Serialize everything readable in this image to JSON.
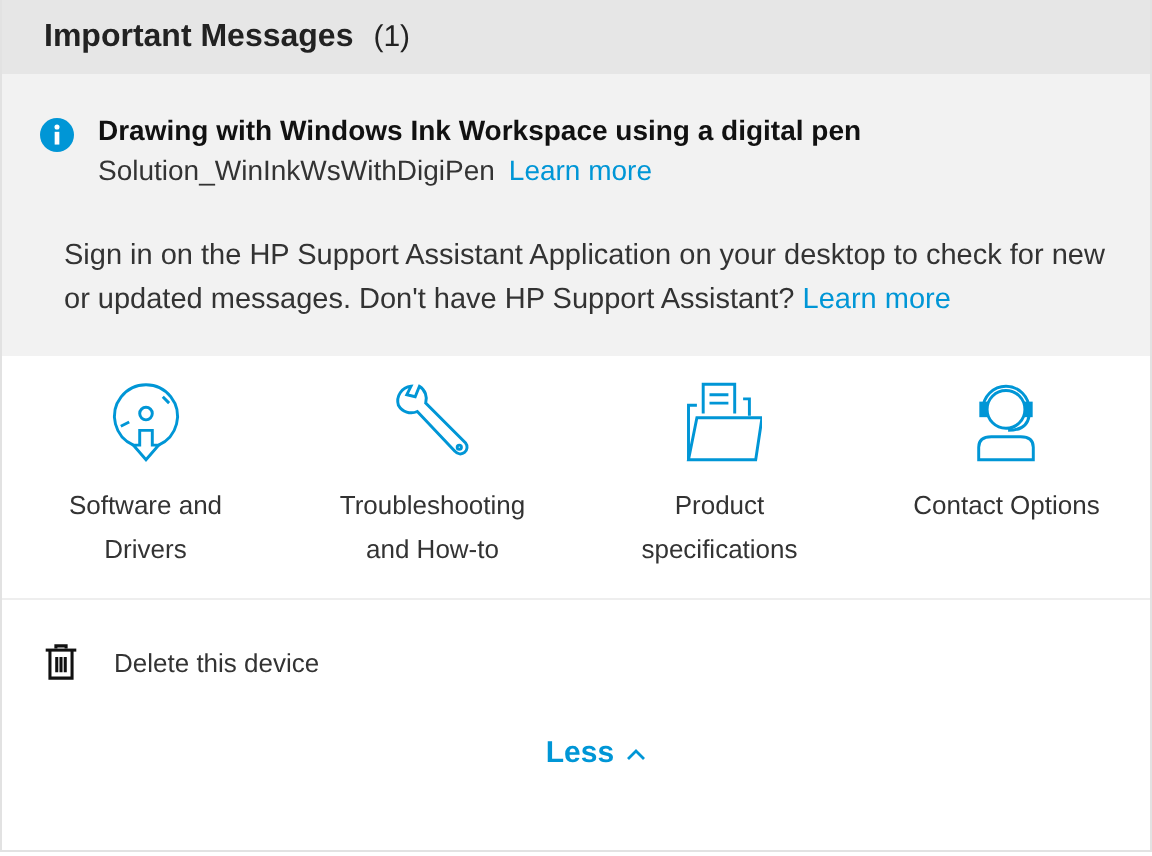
{
  "header": {
    "title": "Important Messages",
    "count": "(1)"
  },
  "message": {
    "title": "Drawing with Windows Ink Workspace using a digital pen",
    "code": "Solution_WinInkWsWithDigiPen",
    "link": "Learn more"
  },
  "notice": {
    "text": "Sign in on the HP Support Assistant Application on your desktop to check for new or updated messages. Don't have HP Support Assistant?",
    "link": "Learn more"
  },
  "tiles": [
    {
      "kind": "disc",
      "label": "Software and Drivers"
    },
    {
      "kind": "wrench",
      "label": "Troubleshooting and How-to"
    },
    {
      "kind": "folder",
      "label": "Product specifications"
    },
    {
      "kind": "headset",
      "label": "Contact Options"
    }
  ],
  "delete": {
    "label": "Delete this device"
  },
  "toggle": {
    "label": "Less",
    "expanded": true
  }
}
